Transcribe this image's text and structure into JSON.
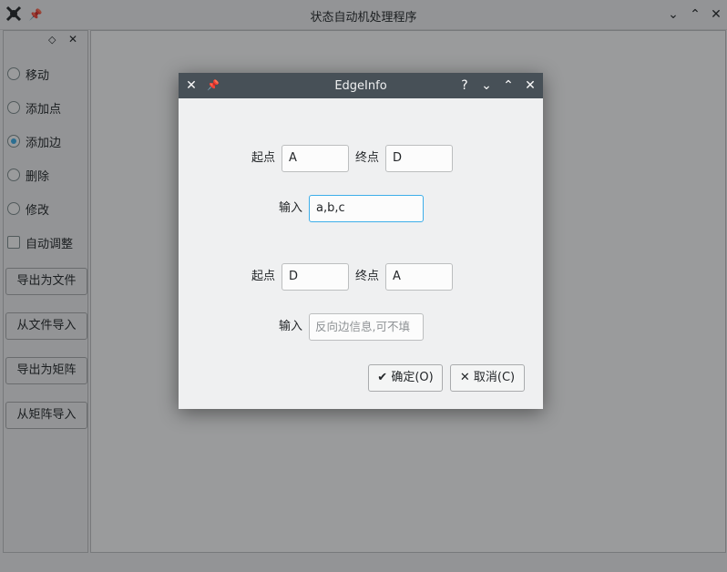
{
  "main_window": {
    "title": "状态自动机处理程序",
    "dock": {
      "modes": [
        {
          "label": "移动",
          "selected": false
        },
        {
          "label": "添加点",
          "selected": false
        },
        {
          "label": "添加边",
          "selected": true
        },
        {
          "label": "删除",
          "selected": false
        },
        {
          "label": "修改",
          "selected": false
        }
      ],
      "auto_adjust_label": "自动调整",
      "buttons": [
        "导出为文件",
        "从文件导入",
        "导出为矩阵",
        "从矩阵导入"
      ]
    }
  },
  "dialog": {
    "title": "EdgeInfo",
    "help_glyph": "?",
    "edge1": {
      "start_label": "起点",
      "start_value": "A",
      "end_label": "终点",
      "end_value": "D",
      "input_label": "输入",
      "input_value": "a,b,c"
    },
    "edge2": {
      "start_label": "起点",
      "start_value": "D",
      "end_label": "终点",
      "end_value": "A",
      "input_label": "输入",
      "input_placeholder": "反向边信息,可不填"
    },
    "ok_label": "确定(O)",
    "cancel_label": "取消(C)"
  }
}
